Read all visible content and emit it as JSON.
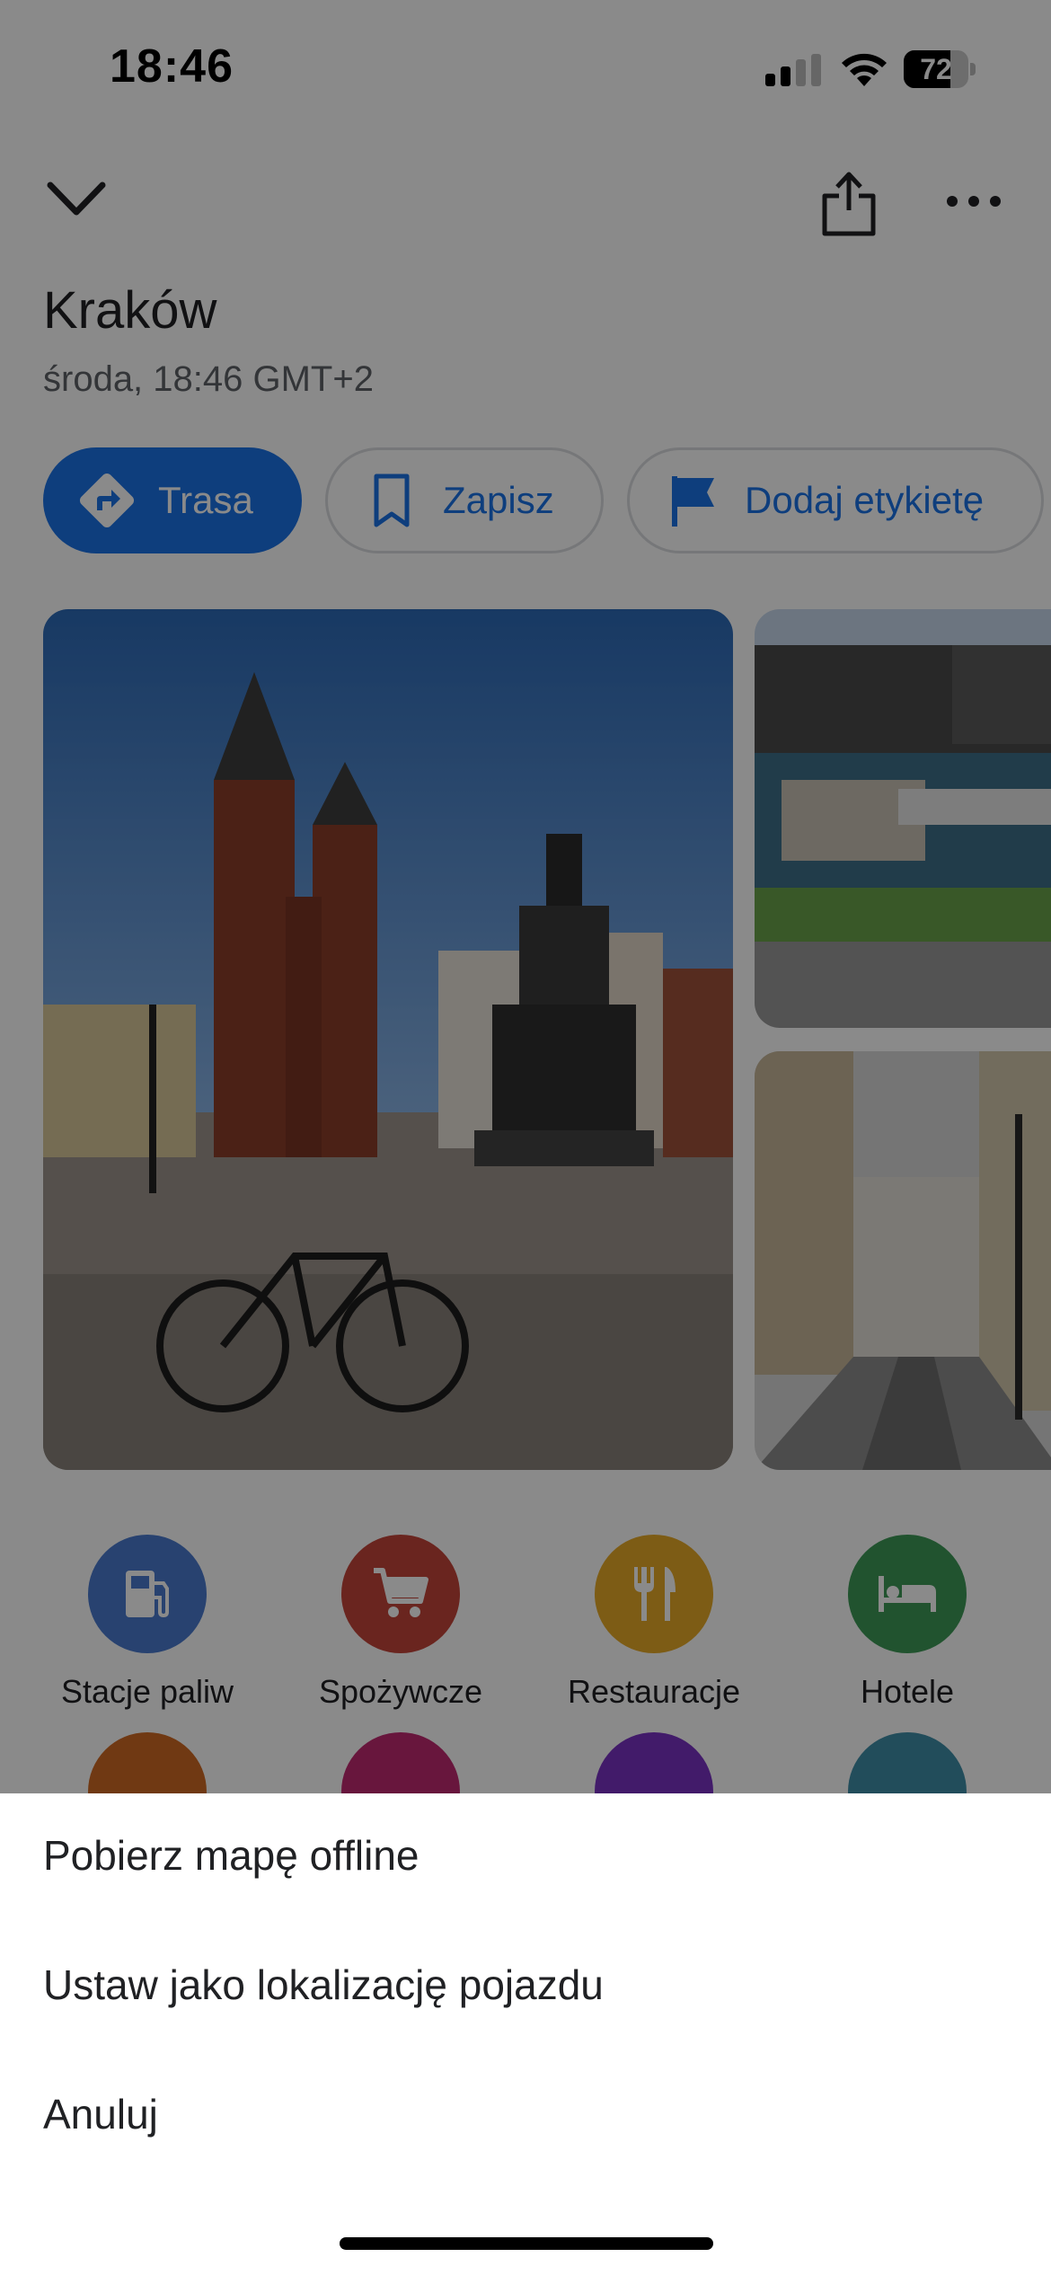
{
  "status_bar": {
    "time": "18:46",
    "battery": "72",
    "battery_level": 0.72
  },
  "header": {
    "collapse_icon": "chevron-down-icon",
    "share_icon": "share-icon",
    "more_icon": "more-horizontal-icon"
  },
  "place": {
    "title": "Kraków",
    "subtitle": "środa, 18:46 GMT+2"
  },
  "actions": {
    "route_label": "Trasa",
    "save_label": "Zapisz",
    "label_label": "Dodaj etykietę"
  },
  "categories": [
    {
      "label": "Stacje paliw",
      "icon": "gas-station-icon",
      "color": "#4a7bd0"
    },
    {
      "label": "Spożywcze",
      "icon": "shopping-cart-icon",
      "color": "#c5453a"
    },
    {
      "label": "Restauracje",
      "icon": "restaurant-icon",
      "color": "#e8aa27"
    },
    {
      "label": "Hotele",
      "icon": "hotel-icon",
      "color": "#3d9a58"
    }
  ],
  "categories_row2_colors": [
    "#d06a24",
    "#c02a72",
    "#7b33c4",
    "#3f8ea8"
  ],
  "sheet": {
    "items": [
      "Pobierz mapę offline",
      "Ustaw jako lokalizację pojazdu",
      "Anuluj"
    ]
  },
  "colors": {
    "accent": "#1a73e8",
    "scrim": "rgba(0,0,0,0.46)"
  }
}
